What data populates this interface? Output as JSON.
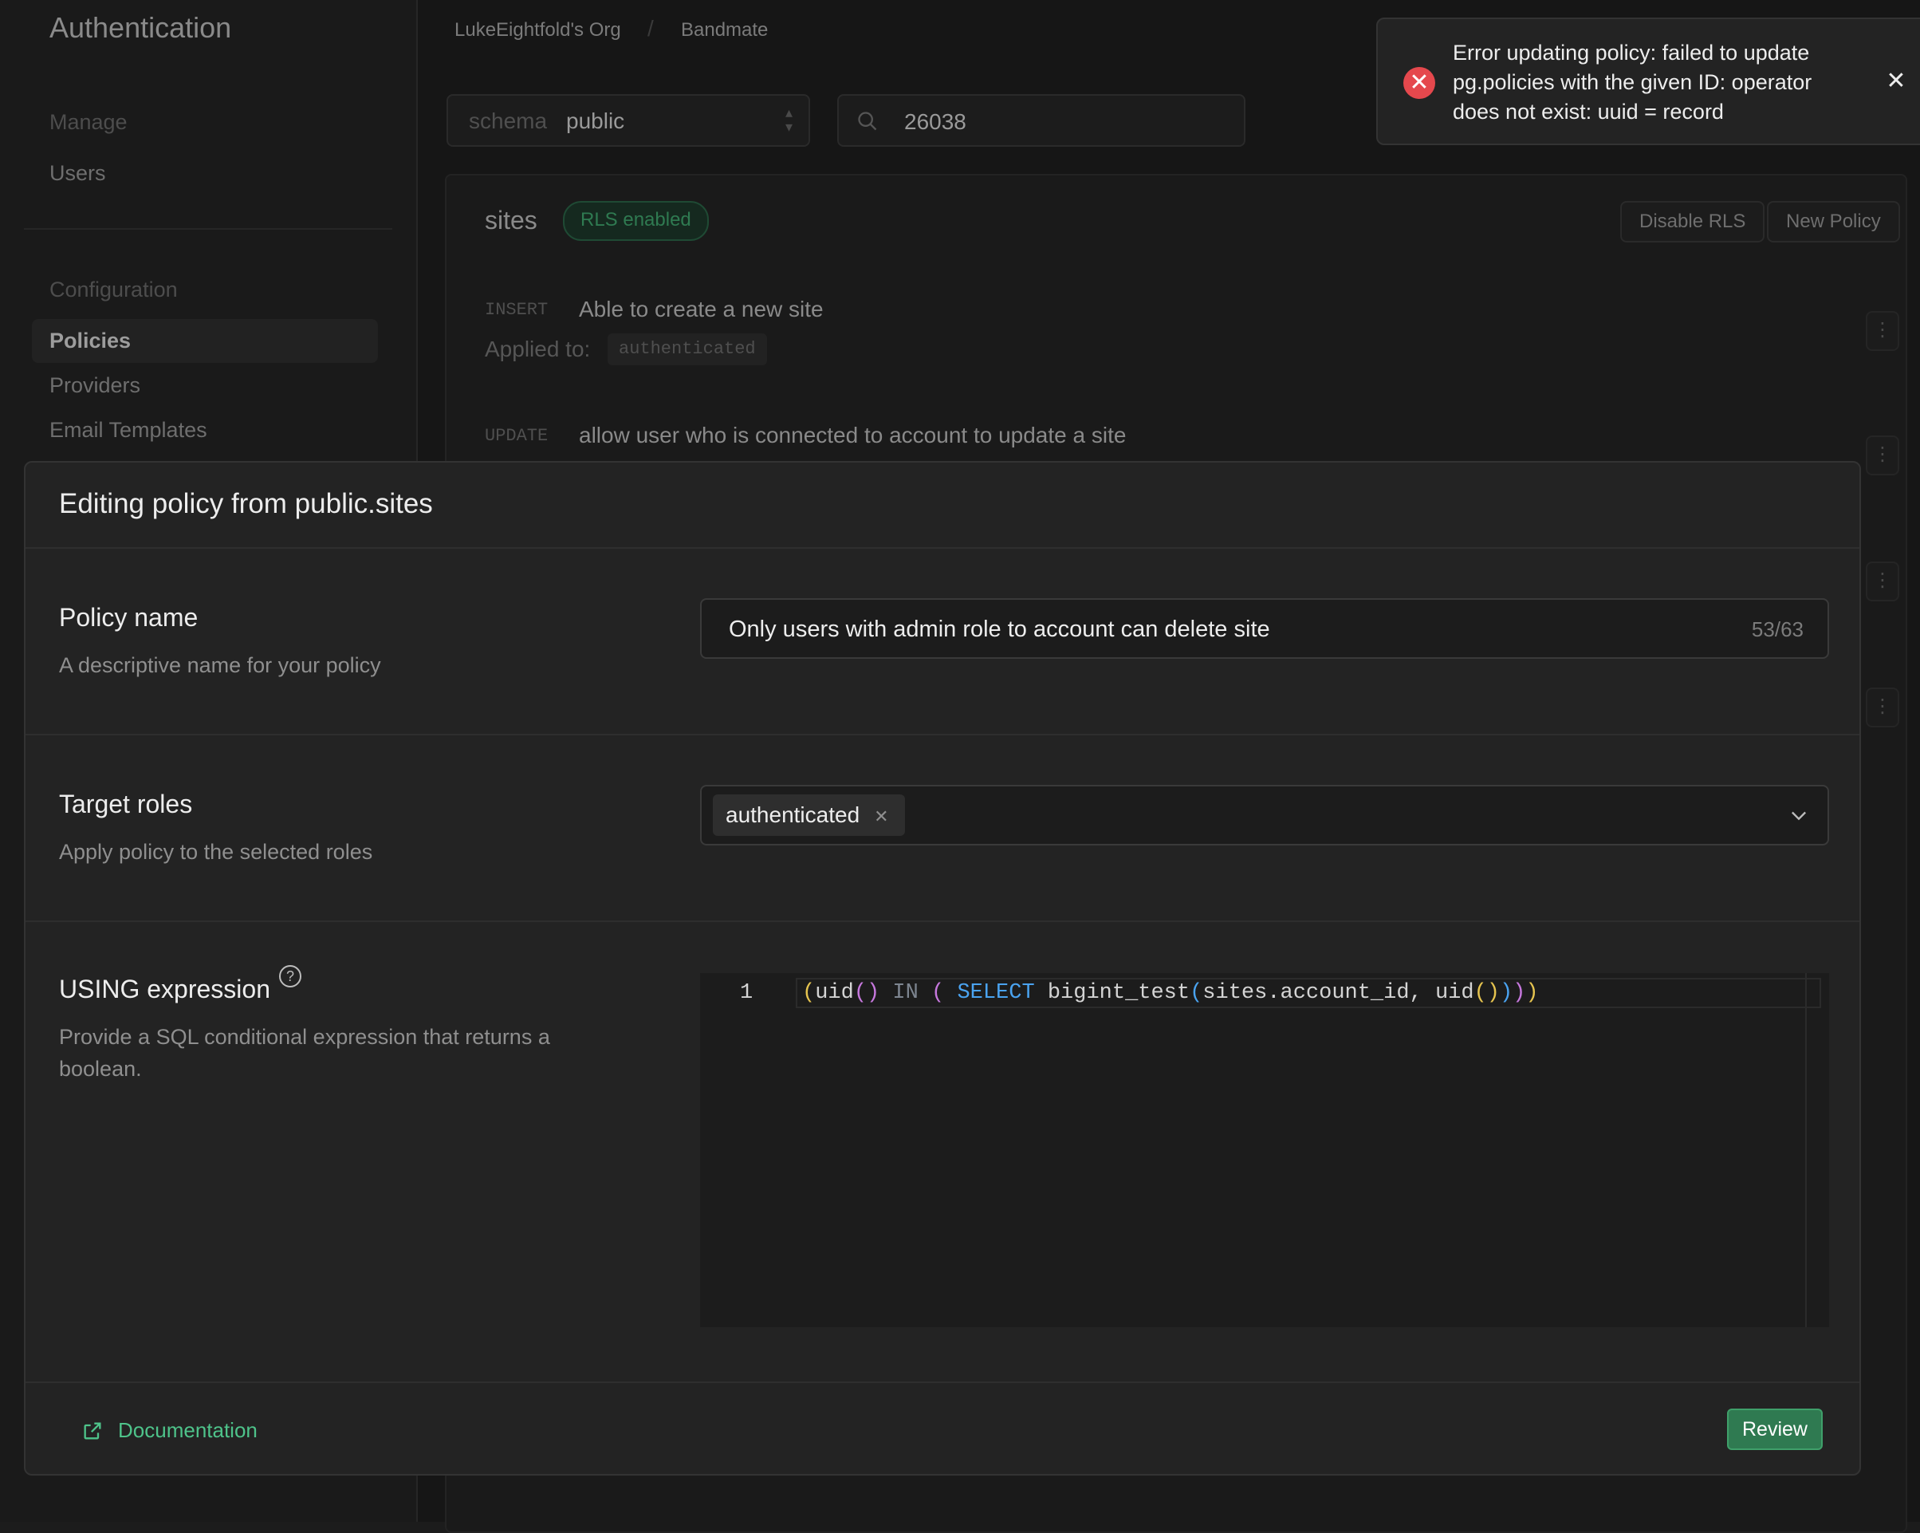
{
  "sidebar": {
    "title": "Authentication",
    "manage_section": "Manage",
    "manage_items": [
      "Users"
    ],
    "config_section": "Configuration",
    "config_items": [
      "Policies",
      "Providers",
      "Email Templates"
    ],
    "active_item": "Policies"
  },
  "breadcrumb": {
    "org": "LukeEightfold's Org",
    "project": "Bandmate"
  },
  "toolbar": {
    "schema_label": "schema",
    "schema_value": "public",
    "search_value": "26038"
  },
  "table": {
    "name": "sites",
    "rls_badge": "RLS enabled",
    "disable_rls_label": "Disable RLS",
    "new_policy_label": "New Policy",
    "policies": [
      {
        "command": "INSERT",
        "name": "Able to create a new site",
        "applied_label": "Applied to:",
        "role": "authenticated"
      },
      {
        "command": "UPDATE",
        "name": "allow user who is connected to account to update a site"
      }
    ]
  },
  "toast": {
    "message": "Error updating policy: failed to update pg.policies with the given ID: operator does not exist: uuid = record",
    "icon": "error-icon",
    "status_color": "#e5484d"
  },
  "modal": {
    "title": "Editing policy from public.sites",
    "policy_name_title": "Policy name",
    "policy_name_desc": "A descriptive name for your policy",
    "policy_name_value": "Only users with admin role to account can delete site",
    "policy_name_count": "53/63",
    "target_roles_title": "Target roles",
    "target_roles_desc": "Apply policy to the selected roles",
    "target_roles_selected": [
      "authenticated"
    ],
    "using_title": "USING expression",
    "using_desc": "Provide a SQL conditional expression that returns a boolean.",
    "using_line_number": "1",
    "using_expression": "(uid() IN ( SELECT bigint_test(sites.account_id, uid())))",
    "documentation_label": "Documentation",
    "review_label": "Review",
    "accent_color": "#2f7a51"
  }
}
